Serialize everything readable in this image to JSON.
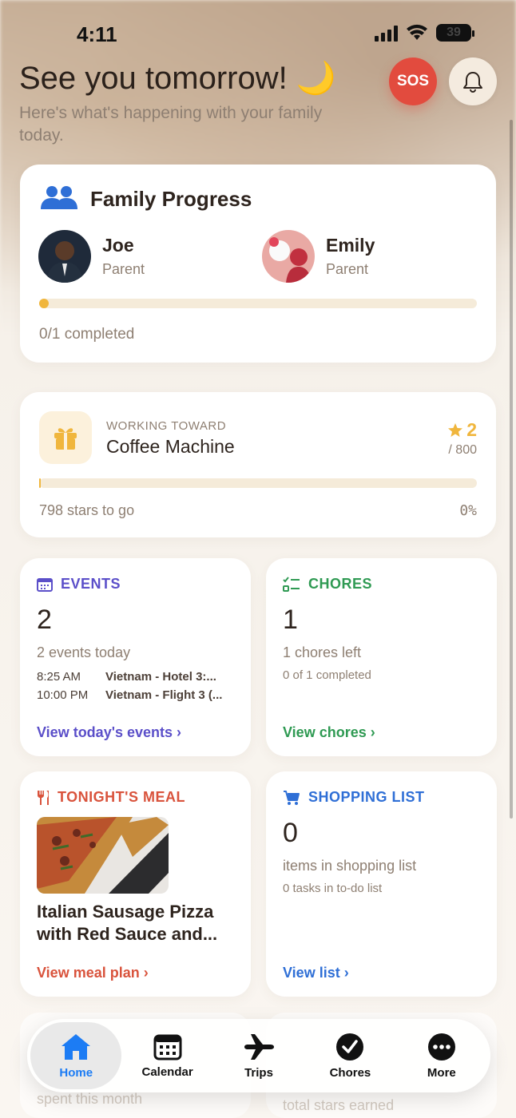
{
  "status_bar": {
    "time": "4:11",
    "battery": "39"
  },
  "header": {
    "greeting": "See you tomorrow! 🌙",
    "subtitle": "Here's what's happening with your family today.",
    "sos_label": "SOS"
  },
  "family_progress": {
    "title": "Family Progress",
    "members": [
      {
        "name": "Joe",
        "role": "Parent"
      },
      {
        "name": "Emily",
        "role": "Parent"
      }
    ],
    "progress_fraction": 0.01,
    "completed_text": "0/1 completed"
  },
  "goal": {
    "label": "WORKING TOWARD",
    "name": "Coffee Machine",
    "stars": "2",
    "total": "/ 800",
    "stars_to_go": "798 stars to go",
    "percent": "0%",
    "progress_fraction": 0.0025
  },
  "events": {
    "title": "EVENTS",
    "count": "2",
    "subtitle": "2 events today",
    "items": [
      {
        "time": "8:25 AM",
        "name": "Vietnam - Hotel 3:..."
      },
      {
        "time": "10:00 PM",
        "name": "Vietnam - Flight 3 (..."
      }
    ],
    "link": "View today's events"
  },
  "chores": {
    "title": "CHORES",
    "count": "1",
    "subtitle": "1 chores left",
    "detail": "0 of 1 completed",
    "link": "View chores"
  },
  "meal": {
    "title": "TONIGHT'S MEAL",
    "name": "Italian Sausage Pizza with Red Sauce and...",
    "link": "View meal plan"
  },
  "shopping": {
    "title": "SHOPPING LIST",
    "count": "0",
    "subtitle": "items in shopping list",
    "detail": "0 tasks in to-do list",
    "link": "View list"
  },
  "peek": {
    "left_text": "spent this month",
    "right_text": "total stars earned"
  },
  "tabs": [
    {
      "label": "Home",
      "icon": "home-icon",
      "active": true
    },
    {
      "label": "Calendar",
      "icon": "calendar-icon",
      "active": false
    },
    {
      "label": "Trips",
      "icon": "airplane-icon",
      "active": false
    },
    {
      "label": "Chores",
      "icon": "checkmark-circle-icon",
      "active": false
    },
    {
      "label": "More",
      "icon": "more-icon",
      "active": false
    }
  ],
  "colors": {
    "accent_blue": "#1c7cf4",
    "sos_red": "#e24b3e",
    "star_gold": "#f0b63d",
    "events_purple": "#5b4fc9",
    "chores_green": "#2f9a53",
    "meal_red": "#d9533c",
    "shopping_blue": "#2f6fd6"
  }
}
